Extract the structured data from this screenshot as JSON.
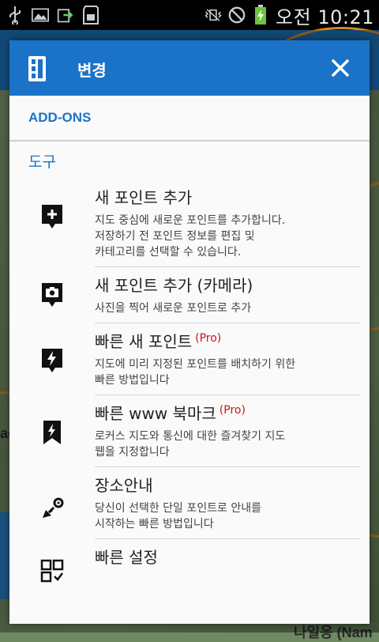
{
  "status_bar": {
    "time": "오전 10:21"
  },
  "background": {
    "labels": [
      "ae",
      "나일옹 (Nam"
    ]
  },
  "dialog": {
    "title": "변경",
    "addons_label": "ADD-ONS",
    "section_label": "도구",
    "items": [
      {
        "title": "새 포인트 추가",
        "pro": "",
        "desc": "지도 중심에 새로운 포인트를 추가합니다.\n저장하기 전 포인트 정보를 편집 및\n카테고리를 선택할 수 있습니다.",
        "icon": "add-point-icon"
      },
      {
        "title": "새 포인트 추가 (카메라)",
        "pro": "",
        "desc": "사진을 찍어 새로운 포인트로 추가",
        "icon": "camera-point-icon"
      },
      {
        "title": "빠른 새 포인트",
        "pro": "(Pro)",
        "desc": "지도에 미리 지정된 포인트를 배치하기 위한\n빠른 방법입니다",
        "icon": "quick-point-icon"
      },
      {
        "title": "빠른 www 북마크",
        "pro": "(Pro)",
        "desc": "로커스 지도와 통신에 대한 즐겨찾기 지도\n웹을 지정합니다",
        "icon": "quick-bookmark-icon"
      },
      {
        "title": "장소안내",
        "pro": "",
        "desc": "당신이 선택한 단일 포인트로 안내를\n시작하는 빠른 방법입니다",
        "icon": "guidance-icon"
      },
      {
        "title": "빠른 설정",
        "pro": "",
        "desc": "",
        "icon": "quick-settings-icon"
      }
    ]
  }
}
